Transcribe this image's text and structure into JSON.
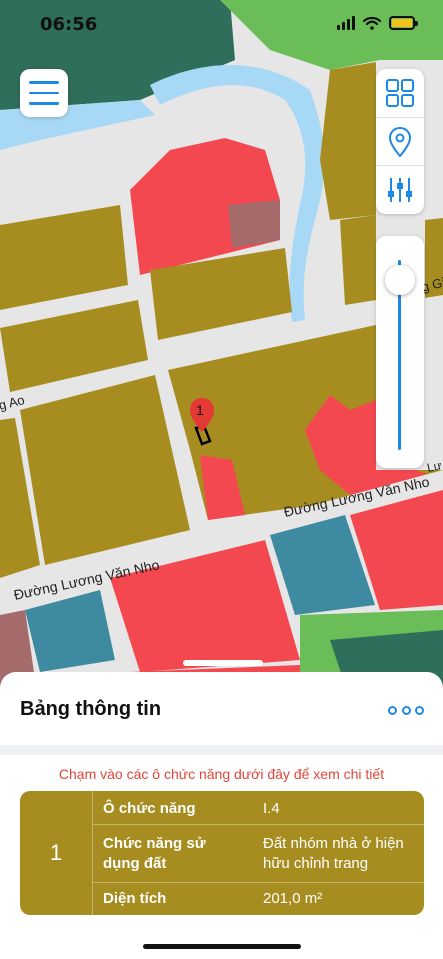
{
  "status_bar": {
    "time": "06:56"
  },
  "map": {
    "road_labels": [
      "Đường Lương Văn Nho",
      "Đường Lương Văn Nho",
      "Đường Gi",
      "g Ao",
      "Lư"
    ],
    "marker_label": "1",
    "colors": {
      "residential": "#a78d20",
      "commercial": "#f44850",
      "water": "#a7d8f5",
      "park": "#2f6e5a",
      "green": "#6bbd57",
      "teal": "#3e8aa0",
      "road": "#e6e6e6"
    }
  },
  "toolbar": {
    "menu_icon": "hamburger-menu-icon",
    "layers_icon": "grid-layers-icon",
    "location_icon": "location-pin-icon",
    "filter_icon": "sliders-icon"
  },
  "zoom": {
    "level": 0.95
  },
  "info_panel": {
    "title": "Bảng thông tin",
    "more_icon": "more-dots-icon",
    "hint": "Chạm vào các ô chức năng dưới đây để xem chi tiết",
    "card": {
      "index": "1",
      "rows": [
        {
          "label": "Ô chức năng",
          "value": "I.4"
        },
        {
          "label": "Chức năng sử dụng đất",
          "value": "Đất nhóm nhà ở hiện hữu chỉnh trang"
        },
        {
          "label": "Diện tích",
          "value": "201,0 m²"
        }
      ]
    }
  }
}
